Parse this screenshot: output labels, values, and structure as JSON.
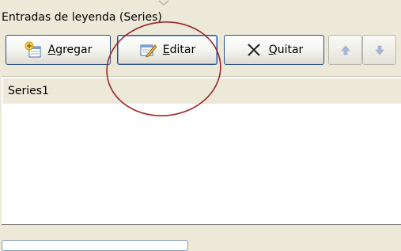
{
  "group": {
    "label": "Entradas de leyenda (Series)"
  },
  "toolbar": {
    "add": {
      "label": "Agregar",
      "icon": "add-series-icon"
    },
    "edit": {
      "label": "Editar",
      "icon": "edit-pencil-icon"
    },
    "remove": {
      "label": "Quitar",
      "icon": "x-icon"
    },
    "move_up_icon": "arrow-up-icon",
    "move_down_icon": "arrow-down-icon"
  },
  "series_list": {
    "items": [
      "Series1"
    ]
  },
  "colors": {
    "background": "#ece9d8",
    "button_border": "#2e4f86",
    "annotation": "#9b2626"
  }
}
